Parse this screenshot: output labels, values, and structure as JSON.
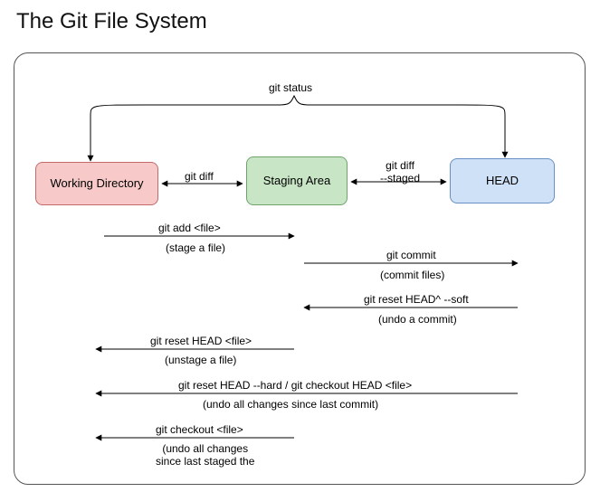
{
  "title": "The Git File System",
  "nodes": {
    "working": "Working Directory",
    "staging": "Staging Area",
    "head": "HEAD"
  },
  "topBrace": "git status",
  "edges": {
    "diff_ws": "git diff",
    "diff_sh": "git diff\n--staged"
  },
  "arrows": {
    "add": {
      "cmd": "git add <file>",
      "note": "(stage a file)"
    },
    "commit": {
      "cmd": "git commit",
      "note": "(commit files)"
    },
    "resetSoft": {
      "cmd": "git reset HEAD^ --soft",
      "note": "(undo a commit)"
    },
    "unstage": {
      "cmd": "git reset HEAD <file>",
      "note": "(unstage a file)"
    },
    "hard": {
      "cmd": "git reset HEAD --hard / git checkout HEAD <file>",
      "note": "(undo all changes since last commit)"
    },
    "checkout": {
      "cmd": "git checkout <file>",
      "note": "(undo all changes\nsince last staged the"
    }
  }
}
